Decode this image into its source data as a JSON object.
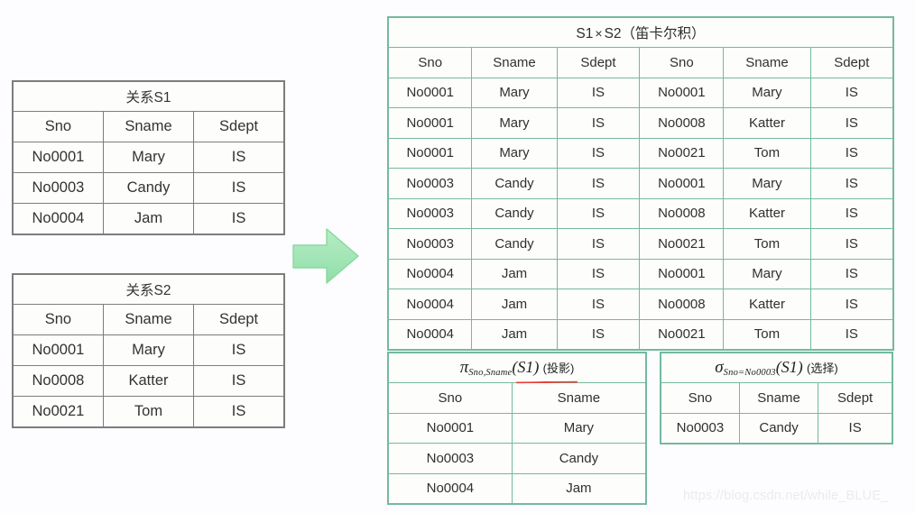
{
  "background_color": "#fdfcfe",
  "colors": {
    "gray_border": "#7d7d7d",
    "green_border": "#74b9a0",
    "red_text": "#fb2b25",
    "blue_text": "#4a4a8c",
    "red_underline": "#e8403a",
    "arrow_fill": "#a9e8bb",
    "arrow_stroke": "#7fd79b",
    "watermark": "#eceaf0"
  },
  "tables": {
    "s1": {
      "title": "关系S1",
      "columns": [
        "Sno",
        "Sname",
        "Sdept"
      ],
      "rows": [
        [
          "No0001",
          "Mary",
          "IS"
        ],
        [
          "No0003",
          "Candy",
          "IS"
        ],
        [
          "No0004",
          "Jam",
          "IS"
        ]
      ]
    },
    "s2": {
      "title": "关系S2",
      "columns": [
        "Sno",
        "Sname",
        "Sdept"
      ],
      "rows": [
        [
          "No0001",
          "Mary",
          "IS"
        ],
        [
          "No0008",
          "Katter",
          "IS"
        ],
        [
          "No0021",
          "Tom",
          "IS"
        ]
      ]
    },
    "product": {
      "title_s1": "S1",
      "title_times": "×",
      "title_s2": "S2",
      "title_note": "（笛卡尔积）",
      "title_full": "S1 × S2（笛卡尔积）",
      "columns": [
        "Sno",
        "Sname",
        "Sdept",
        "Sno",
        "Sname",
        "Sdept"
      ],
      "rows": [
        {
          "left": [
            "No0001",
            "Mary",
            "IS"
          ],
          "right": [
            "No0001",
            "Mary",
            "IS"
          ],
          "right_color": "red"
        },
        {
          "left": [
            "No0001",
            "Mary",
            "IS"
          ],
          "right": [
            "No0008",
            "Katter",
            "IS"
          ],
          "right_color": "red"
        },
        {
          "left": [
            "No0001",
            "Mary",
            "IS"
          ],
          "right": [
            "No0021",
            "Tom",
            "IS"
          ],
          "right_color": "red"
        },
        {
          "left": [
            "No0003",
            "Candy",
            "IS"
          ],
          "right": [
            "No0001",
            "Mary",
            "IS"
          ],
          "right_color": "default"
        },
        {
          "left": [
            "No0003",
            "Candy",
            "IS"
          ],
          "right": [
            "No0008",
            "Katter",
            "IS"
          ],
          "right_color": "default"
        },
        {
          "left": [
            "No0003",
            "Candy",
            "IS"
          ],
          "right": [
            "No0021",
            "Tom",
            "IS"
          ],
          "right_color": "default"
        },
        {
          "left": [
            "No0004",
            "Jam",
            "IS"
          ],
          "right": [
            "No0001",
            "Mary",
            "IS"
          ],
          "right_color": "blue"
        },
        {
          "left": [
            "No0004",
            "Jam",
            "IS"
          ],
          "right": [
            "No0008",
            "Katter",
            "IS"
          ],
          "right_color": "blue"
        },
        {
          "left": [
            "No0004",
            "Jam",
            "IS"
          ],
          "right": [
            "No0021",
            "Tom",
            "IS"
          ],
          "right_color": "blue"
        }
      ]
    },
    "projection": {
      "title_operator": "π",
      "title_subscript": "Sno,Sname",
      "title_argument": "(S1)",
      "title_note": "(投影)",
      "title_full": "π Sno,Sname (S1) (投影)",
      "columns": [
        "Sno",
        "Sname"
      ],
      "rows": [
        [
          "No0001",
          "Mary"
        ],
        [
          "No0003",
          "Candy"
        ],
        [
          "No0004",
          "Jam"
        ]
      ]
    },
    "selection": {
      "title_operator": "σ",
      "title_subscript": "Sno=No0003",
      "title_argument": "(S1)",
      "title_note": "(选择)",
      "title_full": "σ Sno=No0003 (S1) (选择)",
      "columns": [
        "Sno",
        "Sname",
        "Sdept"
      ],
      "rows": [
        [
          "No0003",
          "Candy",
          "IS"
        ]
      ]
    }
  },
  "arrow": {
    "name": "right-arrow",
    "direction": "right"
  },
  "watermark": {
    "text": "https://blog.csdn.net/while_BLUE_"
  }
}
